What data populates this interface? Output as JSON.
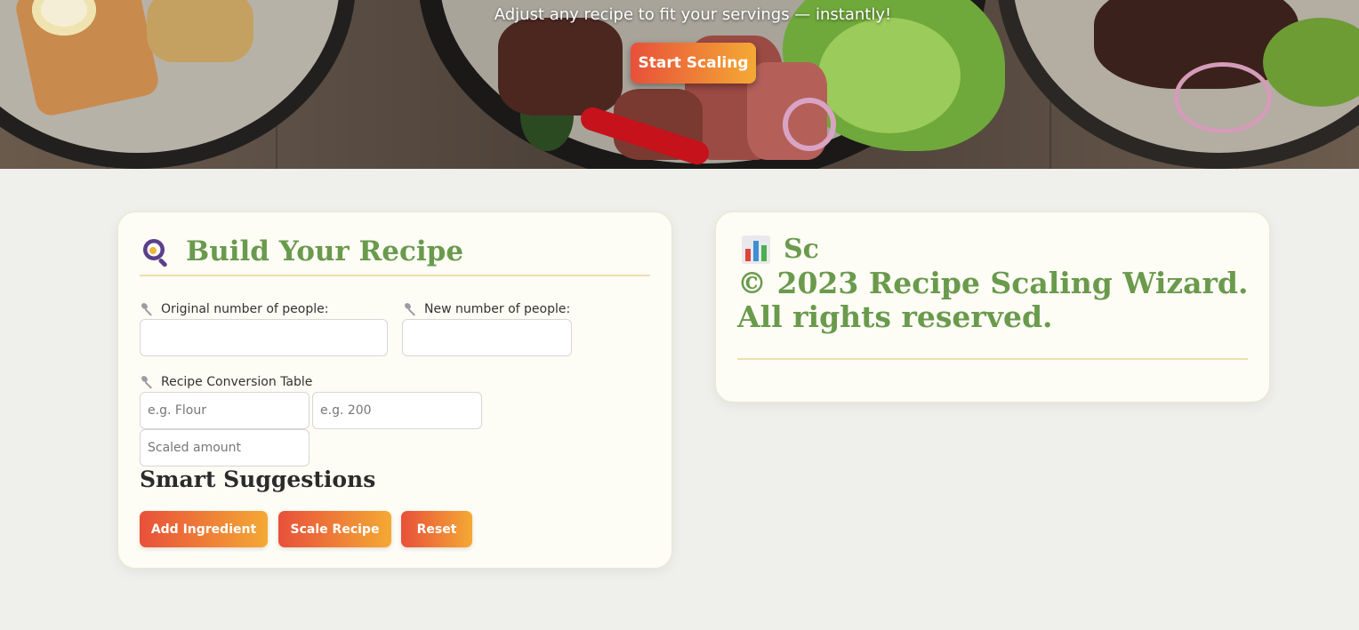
{
  "hero": {
    "tagline": "Adjust any recipe to fit your servings — instantly!",
    "cta_label": "Start Scaling"
  },
  "builder": {
    "title": "Build Your Recipe",
    "title_icon": "magnifier-pan-icon",
    "original_label": "Original number of people:",
    "new_label": "New number of people:",
    "original_value": "",
    "new_value": "",
    "table_label": "Recipe Conversion Table",
    "ingredient_placeholder": "e.g. Flour",
    "amount_placeholder": "e.g. 200",
    "scaled_placeholder": "Scaled amount",
    "suggestions_heading": "Smart Suggestions",
    "buttons": {
      "add": "Add Ingredient",
      "scale": "Scale Recipe",
      "reset": "Reset"
    }
  },
  "results": {
    "title_partial": "Sc",
    "title_icon": "bar-chart-icon",
    "footer_text": "© 2023 Recipe Scaling Wizard. All rights reserved."
  },
  "colors": {
    "accent_green": "#6a9a4c",
    "button_gradient_start": "#e8503a",
    "button_gradient_end": "#f4a934",
    "card_bg": "#fdfcf5",
    "page_bg": "#efefec"
  }
}
